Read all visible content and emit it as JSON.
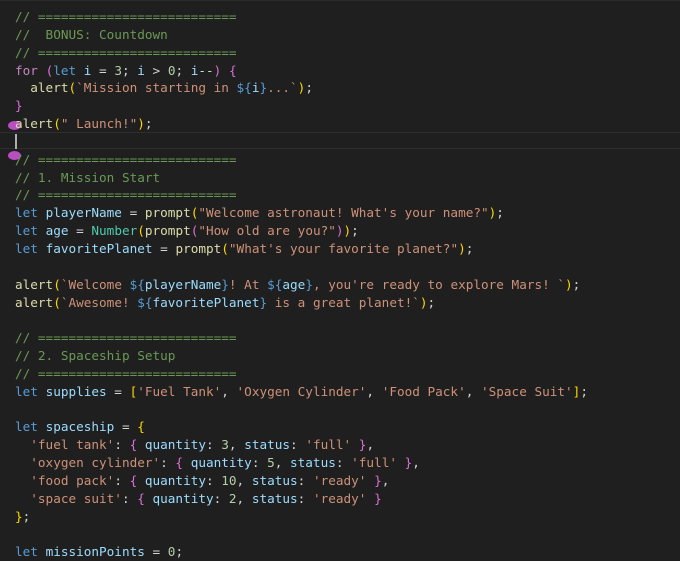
{
  "editor": {
    "lines": [
      {
        "tokens": [
          {
            "t": "// ==========================",
            "c": "comment"
          }
        ]
      },
      {
        "tokens": [
          {
            "t": "//  BONUS: Countdown",
            "c": "comment"
          }
        ]
      },
      {
        "tokens": [
          {
            "t": "// ==========================",
            "c": "comment"
          }
        ]
      },
      {
        "tokens": [
          {
            "t": "for",
            "c": "control"
          },
          {
            "t": " ",
            "c": "punct"
          },
          {
            "t": "(",
            "c": "paren"
          },
          {
            "t": "let",
            "c": "keyword"
          },
          {
            "t": " ",
            "c": "punct"
          },
          {
            "t": "i",
            "c": "variable"
          },
          {
            "t": " = ",
            "c": "punct"
          },
          {
            "t": "3",
            "c": "number"
          },
          {
            "t": "; ",
            "c": "punct"
          },
          {
            "t": "i",
            "c": "variable"
          },
          {
            "t": " > ",
            "c": "punct"
          },
          {
            "t": "0",
            "c": "number"
          },
          {
            "t": "; ",
            "c": "punct"
          },
          {
            "t": "i",
            "c": "variable"
          },
          {
            "t": "--",
            "c": "punct"
          },
          {
            "t": ")",
            "c": "paren"
          },
          {
            "t": " ",
            "c": "punct"
          },
          {
            "t": "{",
            "c": "paren"
          }
        ]
      },
      {
        "tokens": [
          {
            "t": "  ",
            "c": "punct"
          },
          {
            "t": "alert",
            "c": "function"
          },
          {
            "t": "(",
            "c": "brace"
          },
          {
            "t": "`Mission starting in ",
            "c": "string"
          },
          {
            "t": "${",
            "c": "interp"
          },
          {
            "t": "i",
            "c": "variable"
          },
          {
            "t": "}",
            "c": "interp"
          },
          {
            "t": "...`",
            "c": "string"
          },
          {
            "t": ")",
            "c": "brace"
          },
          {
            "t": ";",
            "c": "punct"
          }
        ]
      },
      {
        "tokens": [
          {
            "t": "}",
            "c": "paren"
          }
        ]
      },
      {
        "tokens": [
          {
            "t": "alert",
            "c": "function"
          },
          {
            "t": "(",
            "c": "brace"
          },
          {
            "t": "\" Launch!\"",
            "c": "string"
          },
          {
            "t": ")",
            "c": "brace"
          },
          {
            "t": ";",
            "c": "punct"
          }
        ]
      },
      {
        "tokens": []
      },
      {
        "tokens": [
          {
            "t": "// ==========================",
            "c": "comment"
          }
        ]
      },
      {
        "tokens": [
          {
            "t": "// 1. Mission Start",
            "c": "comment"
          }
        ]
      },
      {
        "tokens": [
          {
            "t": "// ==========================",
            "c": "comment"
          }
        ]
      },
      {
        "tokens": [
          {
            "t": "let",
            "c": "keyword"
          },
          {
            "t": " ",
            "c": "punct"
          },
          {
            "t": "playerName",
            "c": "variable"
          },
          {
            "t": " = ",
            "c": "punct"
          },
          {
            "t": "prompt",
            "c": "function"
          },
          {
            "t": "(",
            "c": "brace"
          },
          {
            "t": "\"Welcome astronaut! What's your name?\"",
            "c": "string"
          },
          {
            "t": ")",
            "c": "brace"
          },
          {
            "t": ";",
            "c": "punct"
          }
        ]
      },
      {
        "tokens": [
          {
            "t": "let",
            "c": "keyword"
          },
          {
            "t": " ",
            "c": "punct"
          },
          {
            "t": "age",
            "c": "variable"
          },
          {
            "t": " = ",
            "c": "punct"
          },
          {
            "t": "Number",
            "c": "class"
          },
          {
            "t": "(",
            "c": "brace"
          },
          {
            "t": "prompt",
            "c": "function"
          },
          {
            "t": "(",
            "c": "paren"
          },
          {
            "t": "\"How old are you?\"",
            "c": "string"
          },
          {
            "t": ")",
            "c": "paren"
          },
          {
            "t": ")",
            "c": "brace"
          },
          {
            "t": ";",
            "c": "punct"
          }
        ]
      },
      {
        "tokens": [
          {
            "t": "let",
            "c": "keyword"
          },
          {
            "t": " ",
            "c": "punct"
          },
          {
            "t": "favoritePlanet",
            "c": "variable"
          },
          {
            "t": " = ",
            "c": "punct"
          },
          {
            "t": "prompt",
            "c": "function"
          },
          {
            "t": "(",
            "c": "brace"
          },
          {
            "t": "\"What's your favorite planet?\"",
            "c": "string"
          },
          {
            "t": ")",
            "c": "brace"
          },
          {
            "t": ";",
            "c": "punct"
          }
        ]
      },
      {
        "tokens": []
      },
      {
        "tokens": [
          {
            "t": "alert",
            "c": "function"
          },
          {
            "t": "(",
            "c": "brace"
          },
          {
            "t": "`Welcome ",
            "c": "string"
          },
          {
            "t": "${",
            "c": "interp"
          },
          {
            "t": "playerName",
            "c": "variable"
          },
          {
            "t": "}",
            "c": "interp"
          },
          {
            "t": "! At ",
            "c": "string"
          },
          {
            "t": "${",
            "c": "interp"
          },
          {
            "t": "age",
            "c": "variable"
          },
          {
            "t": "}",
            "c": "interp"
          },
          {
            "t": ", you're ready to explore Mars! `",
            "c": "string"
          },
          {
            "t": ")",
            "c": "brace"
          },
          {
            "t": ";",
            "c": "punct"
          }
        ]
      },
      {
        "tokens": [
          {
            "t": "alert",
            "c": "function"
          },
          {
            "t": "(",
            "c": "brace"
          },
          {
            "t": "`Awesome! ",
            "c": "string"
          },
          {
            "t": "${",
            "c": "interp"
          },
          {
            "t": "favoritePlanet",
            "c": "variable"
          },
          {
            "t": "}",
            "c": "interp"
          },
          {
            "t": " is a great planet!`",
            "c": "string"
          },
          {
            "t": ")",
            "c": "brace"
          },
          {
            "t": ";",
            "c": "punct"
          }
        ]
      },
      {
        "tokens": []
      },
      {
        "tokens": [
          {
            "t": "// ==========================",
            "c": "comment"
          }
        ]
      },
      {
        "tokens": [
          {
            "t": "// 2. Spaceship Setup",
            "c": "comment"
          }
        ]
      },
      {
        "tokens": [
          {
            "t": "// ==========================",
            "c": "comment"
          }
        ]
      },
      {
        "tokens": [
          {
            "t": "let",
            "c": "keyword"
          },
          {
            "t": " ",
            "c": "punct"
          },
          {
            "t": "supplies",
            "c": "variable"
          },
          {
            "t": " = ",
            "c": "punct"
          },
          {
            "t": "[",
            "c": "brace"
          },
          {
            "t": "'Fuel Tank'",
            "c": "string"
          },
          {
            "t": ", ",
            "c": "punct"
          },
          {
            "t": "'Oxygen Cylinder'",
            "c": "string"
          },
          {
            "t": ", ",
            "c": "punct"
          },
          {
            "t": "'Food Pack'",
            "c": "string"
          },
          {
            "t": ", ",
            "c": "punct"
          },
          {
            "t": "'Space Suit'",
            "c": "string"
          },
          {
            "t": "]",
            "c": "brace"
          },
          {
            "t": ";",
            "c": "punct"
          }
        ]
      },
      {
        "tokens": []
      },
      {
        "tokens": [
          {
            "t": "let",
            "c": "keyword"
          },
          {
            "t": " ",
            "c": "punct"
          },
          {
            "t": "spaceship",
            "c": "variable"
          },
          {
            "t": " = ",
            "c": "punct"
          },
          {
            "t": "{",
            "c": "brace"
          }
        ]
      },
      {
        "tokens": [
          {
            "t": "  ",
            "c": "punct"
          },
          {
            "t": "'fuel tank'",
            "c": "string"
          },
          {
            "t": ": ",
            "c": "punct"
          },
          {
            "t": "{",
            "c": "paren"
          },
          {
            "t": " ",
            "c": "punct"
          },
          {
            "t": "quantity",
            "c": "variable"
          },
          {
            "t": ": ",
            "c": "punct"
          },
          {
            "t": "3",
            "c": "number"
          },
          {
            "t": ", ",
            "c": "punct"
          },
          {
            "t": "status",
            "c": "variable"
          },
          {
            "t": ": ",
            "c": "punct"
          },
          {
            "t": "'full'",
            "c": "string"
          },
          {
            "t": " ",
            "c": "punct"
          },
          {
            "t": "}",
            "c": "paren"
          },
          {
            "t": ",",
            "c": "punct"
          }
        ]
      },
      {
        "tokens": [
          {
            "t": "  ",
            "c": "punct"
          },
          {
            "t": "'oxygen cylinder'",
            "c": "string"
          },
          {
            "t": ": ",
            "c": "punct"
          },
          {
            "t": "{",
            "c": "paren"
          },
          {
            "t": " ",
            "c": "punct"
          },
          {
            "t": "quantity",
            "c": "variable"
          },
          {
            "t": ": ",
            "c": "punct"
          },
          {
            "t": "5",
            "c": "number"
          },
          {
            "t": ", ",
            "c": "punct"
          },
          {
            "t": "status",
            "c": "variable"
          },
          {
            "t": ": ",
            "c": "punct"
          },
          {
            "t": "'full'",
            "c": "string"
          },
          {
            "t": " ",
            "c": "punct"
          },
          {
            "t": "}",
            "c": "paren"
          },
          {
            "t": ",",
            "c": "punct"
          }
        ]
      },
      {
        "tokens": [
          {
            "t": "  ",
            "c": "punct"
          },
          {
            "t": "'food pack'",
            "c": "string"
          },
          {
            "t": ": ",
            "c": "punct"
          },
          {
            "t": "{",
            "c": "paren"
          },
          {
            "t": " ",
            "c": "punct"
          },
          {
            "t": "quantity",
            "c": "variable"
          },
          {
            "t": ": ",
            "c": "punct"
          },
          {
            "t": "10",
            "c": "number"
          },
          {
            "t": ", ",
            "c": "punct"
          },
          {
            "t": "status",
            "c": "variable"
          },
          {
            "t": ": ",
            "c": "punct"
          },
          {
            "t": "'ready'",
            "c": "string"
          },
          {
            "t": " ",
            "c": "punct"
          },
          {
            "t": "}",
            "c": "paren"
          },
          {
            "t": ",",
            "c": "punct"
          }
        ]
      },
      {
        "tokens": [
          {
            "t": "  ",
            "c": "punct"
          },
          {
            "t": "'space suit'",
            "c": "string"
          },
          {
            "t": ": ",
            "c": "punct"
          },
          {
            "t": "{",
            "c": "paren"
          },
          {
            "t": " ",
            "c": "punct"
          },
          {
            "t": "quantity",
            "c": "variable"
          },
          {
            "t": ": ",
            "c": "punct"
          },
          {
            "t": "2",
            "c": "number"
          },
          {
            "t": ", ",
            "c": "punct"
          },
          {
            "t": "status",
            "c": "variable"
          },
          {
            "t": ": ",
            "c": "punct"
          },
          {
            "t": "'ready'",
            "c": "string"
          },
          {
            "t": " ",
            "c": "punct"
          },
          {
            "t": "}",
            "c": "paren"
          }
        ]
      },
      {
        "tokens": [
          {
            "t": "}",
            "c": "brace"
          },
          {
            "t": ";",
            "c": "punct"
          }
        ]
      },
      {
        "tokens": []
      },
      {
        "tokens": [
          {
            "t": "let",
            "c": "keyword"
          },
          {
            "t": " ",
            "c": "punct"
          },
          {
            "t": "missionPoints",
            "c": "variable"
          },
          {
            "t": " = ",
            "c": "punct"
          },
          {
            "t": "0",
            "c": "number"
          },
          {
            "t": ";",
            "c": "punct"
          }
        ]
      }
    ],
    "colors": {
      "background": "#1f1f1f",
      "comment": "#6a9955",
      "keyword": "#569cd6",
      "control": "#c586c0",
      "variable": "#9cdcfe",
      "function": "#dcdcaa",
      "string": "#ce9178",
      "number": "#b5cea8",
      "breakpoint": "#b84fc1"
    }
  }
}
